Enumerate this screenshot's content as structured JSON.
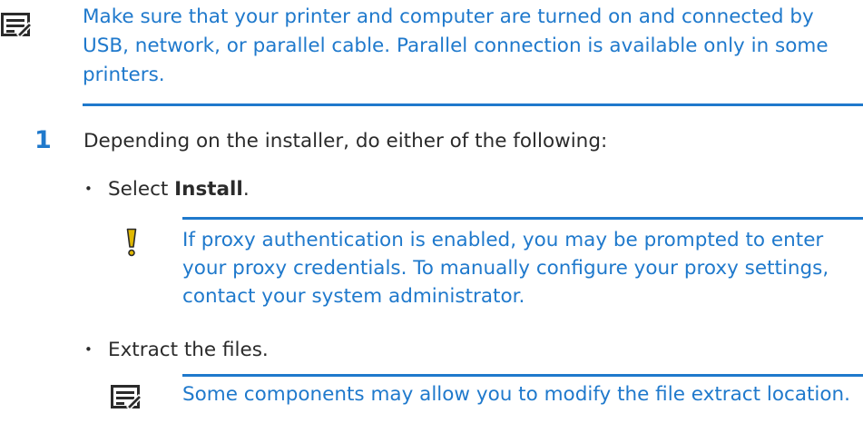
{
  "note_top": {
    "icon": "note-icon",
    "text": "Make sure that your printer and computer are turned on and connected by USB, network, or parallel cable. Parallel connection is available only in some printers."
  },
  "step": {
    "number": "1",
    "text": "Depending on the installer, do either of the following:"
  },
  "bullets": [
    {
      "bullet": "•",
      "prefix": "Select ",
      "bold": "Install",
      "suffix": "."
    },
    {
      "bullet": "•",
      "text": "Extract the files."
    }
  ],
  "caution": {
    "icon": "caution-icon",
    "text": "If proxy authentication is enabled, you may be prompted to enter your proxy credentials. To manually configure your proxy settings, contact your system administrator."
  },
  "note_bottom": {
    "icon": "note-icon",
    "text": "Some components may allow you to modify the file extract location."
  },
  "colors": {
    "accent": "#1f79cc",
    "body_text": "#2b2b2b",
    "caution_icon": "#e0b800"
  }
}
